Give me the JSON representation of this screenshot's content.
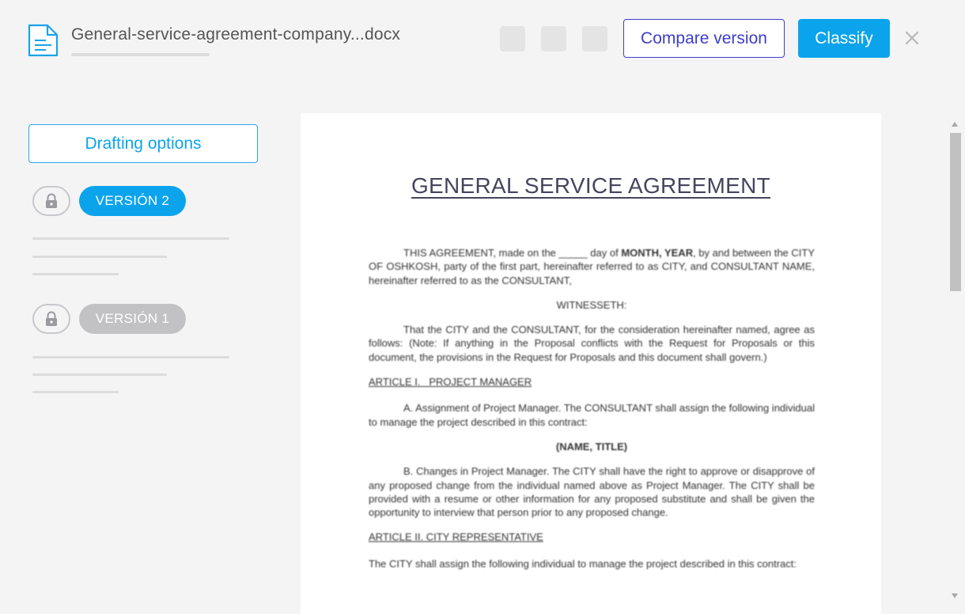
{
  "header": {
    "filename": "General-service-agreement-company...docx",
    "compare_label": "Compare version",
    "classify_label": "Classify",
    "close_icon": "close-icon"
  },
  "sidebar": {
    "drafting_label": "Drafting options",
    "versions": [
      {
        "label": "VERSIÓN 2",
        "active": true
      },
      {
        "label": "VERSIÓN 1",
        "active": false
      }
    ]
  },
  "document": {
    "title": "GENERAL SERVICE AGREEMENT",
    "p1a": "THIS AGREEMENT, made on the _____ day of ",
    "p1b": "MONTH, YEAR",
    "p1c": ", by and between the CITY OF OSHKOSH, party of the first part, hereinafter referred to as CITY, and CONSULTANT NAME, hereinafter referred to as the CONSULTANT,",
    "witnesseth": "WITNESSETH:",
    "p2": "That the CITY and the CONSULTANT, for the consideration hereinafter named, agree as follows: (Note: If anything in the Proposal conflicts with the Request for Proposals or this document, the provisions in the Request for Proposals and this document shall govern.)",
    "article1": "ARTICLE I.   PROJECT MANAGER",
    "p3": "A. Assignment of Project Manager. The CONSULTANT shall assign the following individual to manage the project described in this contract:",
    "name_title": "(NAME, TITLE)",
    "p4": "B. Changes in Project Manager. The CITY shall have the right to approve or disapprove of any proposed change from the individual named above as Project Manager. The CITY shall be provided with a resume or other information for any proposed substitute and shall be given the opportunity to interview that person prior to any proposed change.",
    "article2": "ARTICLE II. CITY REPRESENTATIVE",
    "p5": "The CITY shall assign the following individual to manage the project described in this contract:"
  },
  "colors": {
    "accent": "#0ba4ec",
    "compare_border": "#3d3dcc",
    "inactive_pill": "#c2c2c4",
    "background": "#f4f4f5"
  }
}
